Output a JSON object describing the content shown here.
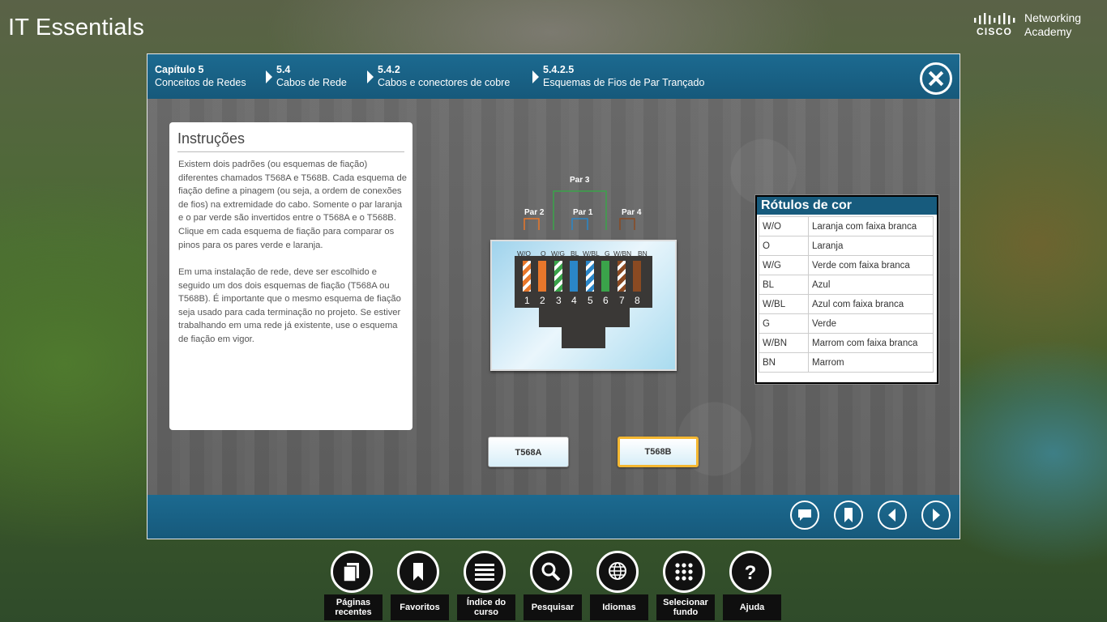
{
  "app": {
    "title": "IT Essentials",
    "brand_word": "CISCO",
    "brand_sub": "Networking Academy"
  },
  "breadcrumb": [
    {
      "num": "Capítulo 5",
      "label": "Conceitos de Redes"
    },
    {
      "num": "5.4",
      "label": "Cabos de Rede"
    },
    {
      "num": "5.4.2",
      "label": "Cabos e conectores de cobre"
    },
    {
      "num": "5.4.2.5",
      "label": "Esquemas de Fios de Par Trançado"
    }
  ],
  "instructions": {
    "title": "Instruções",
    "para1": "Existem dois padrões (ou esquemas de fiação) diferentes chamados T568A e T568B. Cada esquema de fiação define a pinagem (ou seja, a ordem de conexões de fios) na extremidade do cabo. Somente o par laranja e o par verde são invertidos entre o T568A e o T568B. Clique em cada esquema de fiação para comparar os pinos para os pares verde e laranja.",
    "para2": "Em uma instalação de rede, deve ser escolhido e seguido um dos dois esquemas de fiação (T568A ou T568B). É importante que o mesmo esquema de fiação seja usado para cada terminação no projeto. Se estiver trabalhando em uma rede já existente, use o esquema de fiação em vigor."
  },
  "diagram": {
    "pairs": {
      "p1": "Par 1",
      "p2": "Par 2",
      "p3": "Par 3",
      "p4": "Par 4"
    },
    "wires": [
      "W/O",
      "O",
      "W/G",
      "BL",
      "W/BL",
      "G",
      "W/BN",
      "BN"
    ],
    "pins": [
      "1",
      "2",
      "3",
      "4",
      "5",
      "6",
      "7",
      "8"
    ],
    "colors": {
      "orange": "#e8772b",
      "green": "#3aa34a",
      "blue": "#2a86c8",
      "brown": "#8a4a22"
    }
  },
  "legend": {
    "title": "Rótulos de cor",
    "rows": [
      {
        "code": "W/O",
        "desc": "Laranja com faixa branca"
      },
      {
        "code": "O",
        "desc": "Laranja"
      },
      {
        "code": "W/G",
        "desc": "Verde com faixa branca"
      },
      {
        "code": "BL",
        "desc": "Azul"
      },
      {
        "code": "W/BL",
        "desc": "Azul com faixa branca"
      },
      {
        "code": "G",
        "desc": "Verde"
      },
      {
        "code": "W/BN",
        "desc": "Marrom com faixa branca"
      },
      {
        "code": "BN",
        "desc": "Marrom"
      }
    ]
  },
  "buttons": {
    "t568a": "T568A",
    "t568b": "T568B",
    "selected": "T568B"
  },
  "dock": [
    {
      "label": "Páginas recentes",
      "icon": "pages-icon"
    },
    {
      "label": "Favoritos",
      "icon": "bookmark-icon"
    },
    {
      "label": "Índice do curso",
      "icon": "list-icon"
    },
    {
      "label": "Pesquisar",
      "icon": "search-icon"
    },
    {
      "label": "Idiomas",
      "icon": "globe-icon"
    },
    {
      "label": "Selecionar fundo",
      "icon": "grid-icon"
    },
    {
      "label": "Ajuda",
      "icon": "help-icon"
    }
  ]
}
